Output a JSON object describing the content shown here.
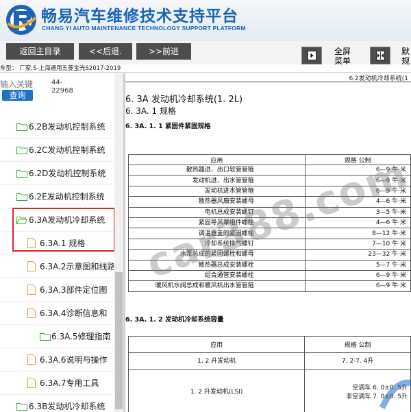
{
  "header": {
    "title_cn": "畅易汽车维修技术支持平台",
    "title_en": "CHANG YI AUTO MAINTENANCE TECHNOLOGY SUPPORT PLATFORM",
    "brand_color": "#1b64b5"
  },
  "toolbar": {
    "home_label": "返回主目录",
    "back_label": "<<后退.",
    "forward_label": ">>前进",
    "fullscreen_label": "全屏\n菜单",
    "split_label": "默\n规"
  },
  "infobar": {
    "car_model": "车型： 厂家:S-上海通用五菱宝光S2017-2019"
  },
  "sidebar": {
    "search_placeholder": "输入关键",
    "search_button": "查询",
    "search_code": "44-\n22968",
    "items": [
      {
        "label": "6.2B发动机控制系统"
      },
      {
        "label": "6.2C发动机控制系统"
      },
      {
        "label": "6.2D发动机控制系统"
      },
      {
        "label": "6.2E发动机控制系统"
      },
      {
        "label": "6.3A发动机冷却系统"
      },
      {
        "label": "6.3A.1 规格"
      },
      {
        "label": "6.3A.2示意图和线路"
      },
      {
        "label": "6.3A.3部件定位图"
      },
      {
        "label": "6.3A.4诊断信息和"
      },
      {
        "label": "6.3A.5修理指南"
      },
      {
        "label": "6.3A.6说明与操作"
      },
      {
        "label": "6.3A.7专用工具"
      },
      {
        "label": "6.3B发动机冷却系统"
      }
    ],
    "highlight_color": "#d9262c"
  },
  "doc": {
    "running_head": "6.2发动机冷却系统(1",
    "h1": "6. 3A  发动机冷却系统(1. 2L)",
    "h2": "6. 3A. 1  规格",
    "h3": "6. 3A. 1. 1  紧固件紧固规格",
    "table1": {
      "headers": [
        "应用",
        "规格  公制"
      ],
      "rows": [
        [
          "散热器进、出口软管管箍",
          "6—9 牛·米"
        ],
        [
          "发动机进、出水管管箍",
          "6—9 牛·米"
        ],
        [
          "发动机进水管管箍",
          "6—9 牛·米"
        ],
        [
          "散热器风扇安装螺母",
          "4—6 牛·米"
        ],
        [
          "电机总成安装螺钉",
          "3—5 牛·米"
        ],
        [
          "紧固导风罩组件螺栓",
          "4—6 牛·米"
        ],
        [
          "调温器盖的紧固螺栓",
          "8—12 牛·米"
        ],
        [
          "冷却系统排气螺钉",
          "7—10 牛·米"
        ],
        [
          "水泵总成的紧固螺栓和螺母",
          "23—32 牛·米"
        ],
        [
          "散热器总成安装螺栓",
          "5—7 牛·米"
        ],
        [
          "组合通管安装螺栓",
          "6—9 牛·米"
        ],
        [
          "暖风机水阀总成和暖风机出水管管箍",
          "6—9 牛·米"
        ]
      ]
    },
    "h4": "6. 3A. 1. 2  发动机冷却系统容量",
    "table2": {
      "headers": [
        "应用",
        "规格  公制"
      ],
      "rows": [
        [
          "1. 2 升发动机",
          "7. 2-7. 4升"
        ],
        [
          "1. 2 升发动机(LSI)",
          "空调车 6. 0±0. 5升\n非空调车 7. 0±0. 5升"
        ]
      ]
    }
  },
  "watermark": "car388.com"
}
